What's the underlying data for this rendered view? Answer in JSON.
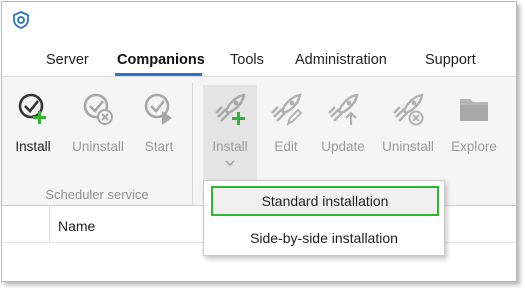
{
  "menu": {
    "items": [
      "Server",
      "Companions",
      "Tools",
      "Administration",
      "Support"
    ],
    "active": "Companions"
  },
  "ribbon": {
    "scheduler_group": {
      "label": "Scheduler service",
      "buttons": [
        {
          "label": "Install",
          "icon": "clock-check-add-icon",
          "enabled": true
        },
        {
          "label": "Uninstall",
          "icon": "clock-check-remove-icon",
          "enabled": false
        },
        {
          "label": "Start",
          "icon": "clock-check-start-icon",
          "enabled": false
        }
      ]
    },
    "companion_group": {
      "buttons": [
        {
          "label": "Install",
          "icon": "rocket-add-icon",
          "enabled": false,
          "pressed": true
        },
        {
          "label": "Edit",
          "icon": "rocket-edit-icon",
          "enabled": false
        },
        {
          "label": "Update",
          "icon": "rocket-update-icon",
          "enabled": false
        },
        {
          "label": "Uninstall",
          "icon": "rocket-remove-icon",
          "enabled": false
        },
        {
          "label": "Explore",
          "icon": "folder-icon",
          "enabled": false
        }
      ]
    }
  },
  "table": {
    "columns": [
      "Name"
    ]
  },
  "dropdown": {
    "items": [
      "Standard installation",
      "Side-by-side installation"
    ],
    "highlighted": "Standard installation"
  },
  "colors": {
    "accent": "#2b73c8",
    "highlight_border": "#2fb62f",
    "add_green": "#35b035"
  }
}
